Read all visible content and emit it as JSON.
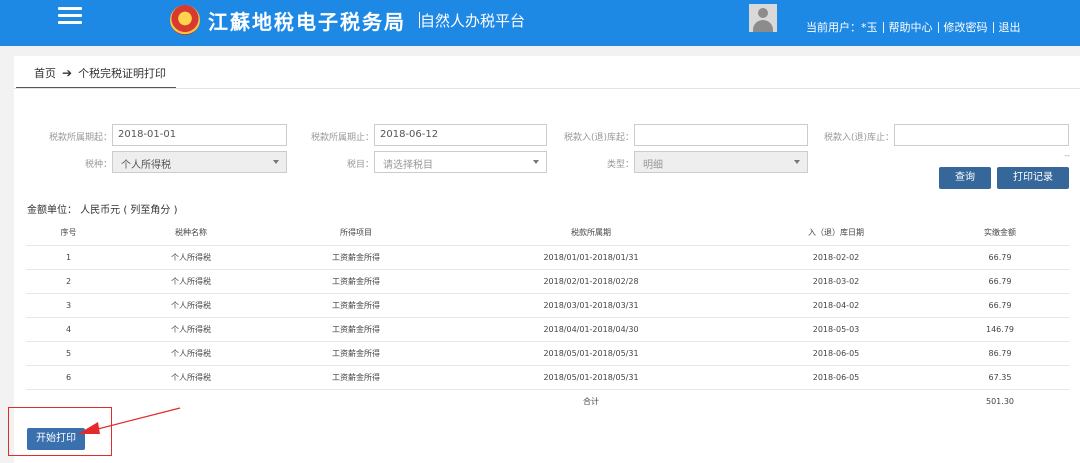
{
  "header": {
    "brand_title": "江蘇地稅电子税务局",
    "brand_subtitle": "自然人办税平台",
    "user_label": "当前用户：",
    "user_name": "*玉",
    "links": [
      "帮助中心",
      "修改密码",
      "退出"
    ]
  },
  "breadcrumb": {
    "home": "首页",
    "current": "个税完税证明打印"
  },
  "form": {
    "period_start_label": "税款所属期起：",
    "period_start_value": "2018-01-01",
    "period_end_label": "税款所属期止：",
    "period_end_value": "2018-06-12",
    "storage_start_label": "税款入(退)库起：",
    "storage_start_value": "",
    "storage_end_label": "税款入(退)库止：",
    "storage_end_value": "",
    "tax_type_label": "税种：",
    "tax_type_value": "个人所得税",
    "tax_item_label": "税目：",
    "tax_item_placeholder": "请选择税目",
    "category_label": "类型：",
    "category_value": "明细",
    "dash_marker": "--"
  },
  "buttons": {
    "query": "查询",
    "print_record": "打印记录",
    "start_print": "开始打印"
  },
  "unit_note": "金额单位： 人民币元 ( 列至角分 )",
  "table": {
    "columns": [
      "序号",
      "税种名称",
      "所得项目",
      "税款所属期",
      "入（退）库日期",
      "实缴金额"
    ],
    "rows": [
      [
        "1",
        "个人所得税",
        "工资薪金所得",
        "2018/01/01-2018/01/31",
        "2018-02-02",
        "66.79"
      ],
      [
        "2",
        "个人所得税",
        "工资薪金所得",
        "2018/02/01-2018/02/28",
        "2018-03-02",
        "66.79"
      ],
      [
        "3",
        "个人所得税",
        "工资薪金所得",
        "2018/03/01-2018/03/31",
        "2018-04-02",
        "66.79"
      ],
      [
        "4",
        "个人所得税",
        "工资薪金所得",
        "2018/04/01-2018/04/30",
        "2018-05-03",
        "146.79"
      ],
      [
        "5",
        "个人所得税",
        "工资薪金所得",
        "2018/05/01-2018/05/31",
        "2018-06-05",
        "86.79"
      ],
      [
        "6",
        "个人所得税",
        "工资薪金所得",
        "2018/05/01-2018/05/31",
        "2018-06-05",
        "67.35"
      ]
    ],
    "total_label": "合计",
    "total_value": "501.30"
  },
  "colors": {
    "header_bg": "#1e88e5",
    "button_bg": "#35679a",
    "annotation": "#e32b2b"
  }
}
